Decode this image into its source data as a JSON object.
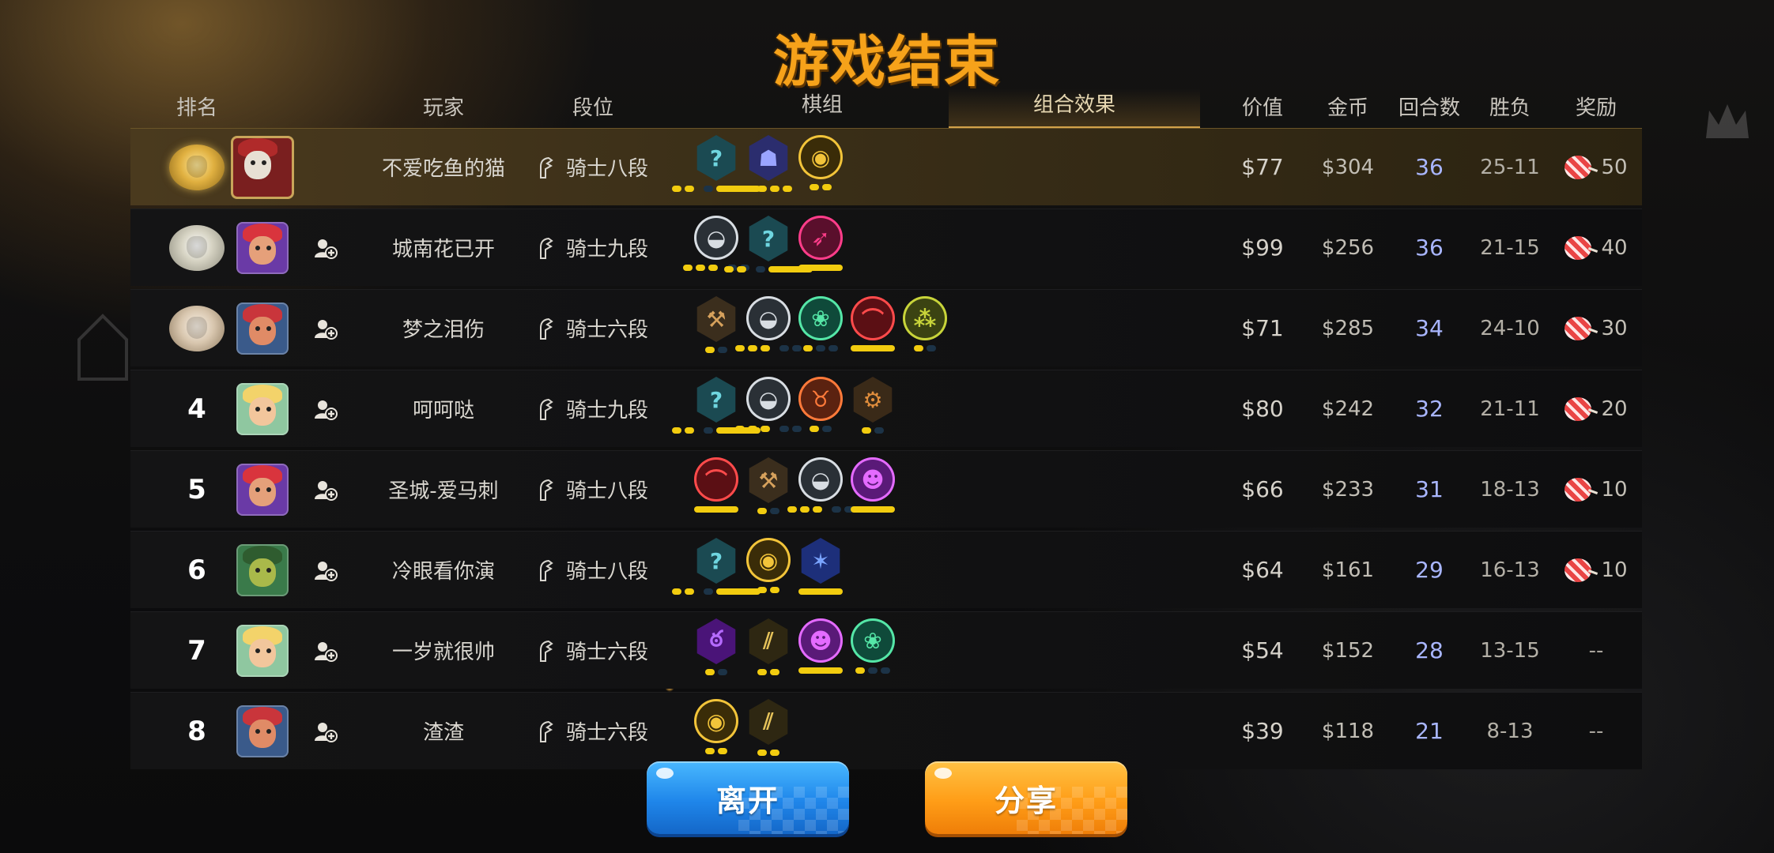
{
  "title": "游戏结束",
  "headers": {
    "rank": "排名",
    "player": "玩家",
    "tier": "段位",
    "board": "棋组",
    "synergy": "组合效果",
    "value": "价值",
    "gold": "金币",
    "rounds": "回合数",
    "winloss": "胜负",
    "reward": "奖励"
  },
  "rows": [
    {
      "rank_display": "medal-gold",
      "name": "不爱吃鱼的猫",
      "tier": "骑士八段",
      "value": "$77",
      "gold": "$304",
      "rounds": "36",
      "winloss": "25-11",
      "reward": "50",
      "has_reward": true,
      "avatar": "mask",
      "syn": [
        "crest-teal",
        "crest-purple",
        "eye-gold"
      ]
    },
    {
      "rank_display": "medal-silver",
      "name": "城南花已开",
      "tier": "骑士九段",
      "value": "$99",
      "gold": "$256",
      "rounds": "36",
      "winloss": "21-15",
      "reward": "40",
      "has_reward": true,
      "avatar": "pirate",
      "syn": [
        "cap-gray",
        "crest-teal",
        "bat-pink"
      ]
    },
    {
      "rank_display": "medal-bronze",
      "name": "梦之泪伤",
      "tier": "骑士六段",
      "value": "$71",
      "gold": "$285",
      "rounds": "34",
      "winloss": "24-10",
      "reward": "30",
      "has_reward": true,
      "avatar": "red-girl",
      "syn": [
        "axe-brown",
        "cap-gray",
        "paw-green",
        "arc-red",
        "triple-olive"
      ]
    },
    {
      "rank_display": "4",
      "name": "呵呵哒",
      "tier": "骑士九段",
      "value": "$80",
      "gold": "$242",
      "rounds": "32",
      "winloss": "21-11",
      "reward": "20",
      "has_reward": true,
      "avatar": "elf",
      "syn": [
        "crest-teal",
        "cap-gray",
        "horn-orange",
        "gear-brown"
      ]
    },
    {
      "rank_display": "5",
      "name": "圣城-爱马刺",
      "tier": "骑士八段",
      "value": "$66",
      "gold": "$233",
      "rounds": "31",
      "winloss": "18-13",
      "reward": "10",
      "has_reward": true,
      "avatar": "pirate",
      "syn": [
        "arc-red",
        "axe-brown",
        "cap-gray",
        "demon-purple"
      ]
    },
    {
      "rank_display": "6",
      "name": "冷眼看你演",
      "tier": "骑士八段",
      "value": "$64",
      "gold": "$161",
      "rounds": "29",
      "winloss": "16-13",
      "reward": "10",
      "has_reward": true,
      "avatar": "frog",
      "syn": [
        "crest-teal",
        "eye-gold",
        "dragon-blue"
      ]
    },
    {
      "rank_display": "7",
      "name": "一岁就很帅",
      "tier": "骑士六段",
      "value": "$54",
      "gold": "$152",
      "rounds": "28",
      "winloss": "13-15",
      "reward": "--",
      "has_reward": false,
      "avatar": "elf",
      "syn": [
        "flame-purple",
        "claw-gold",
        "demon-purple",
        "paw-green"
      ]
    },
    {
      "rank_display": "8",
      "name": "渣渣",
      "tier": "骑士六段",
      "value": "$39",
      "gold": "$118",
      "rounds": "21",
      "winloss": "8-13",
      "reward": "--",
      "has_reward": false,
      "avatar": "red-girl",
      "syn": [
        "eye-gold",
        "claw-gold"
      ]
    }
  ],
  "buttons": {
    "leave": "离开",
    "share": "分享"
  },
  "colors": {
    "title": "#f6a21a",
    "rounds": "#a9b6ff",
    "pip_on": "#f2cc0f",
    "leave": "#1f86ea",
    "share": "#ff9d17"
  }
}
